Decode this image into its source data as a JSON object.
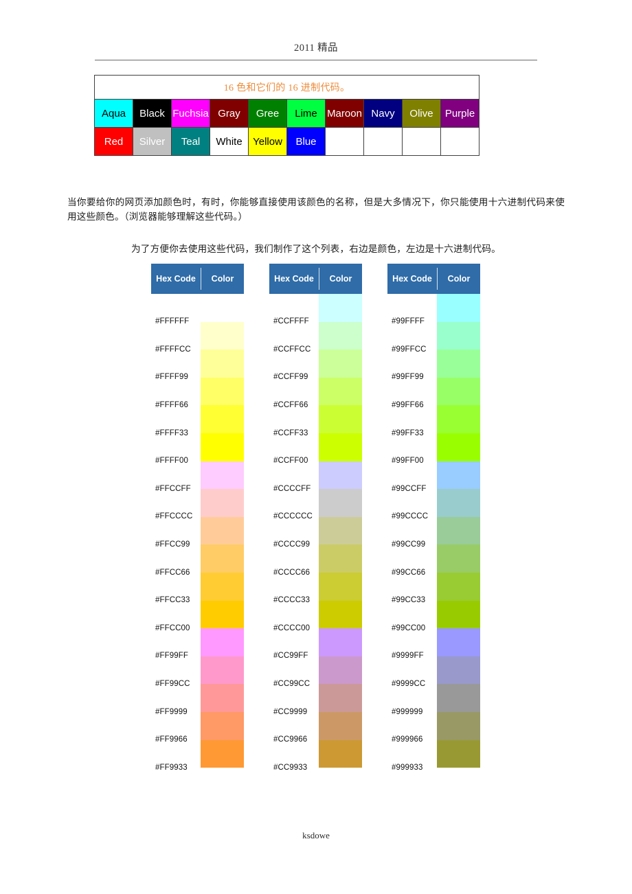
{
  "page": {
    "header_text": "2011 精品",
    "footer_text": "ksdowe"
  },
  "legend": {
    "title": "16 色和它们的 16 进制代码。",
    "title_color": "#ED8B3A",
    "row1": [
      {
        "label": "Aqua",
        "bg": "#00FFFF",
        "fg": "#000000"
      },
      {
        "label": "Black",
        "bg": "#000000",
        "fg": "#FFFFFF"
      },
      {
        "label": "Fuchsia",
        "bg": "#FF00FF",
        "fg": "#FFFFFF"
      },
      {
        "label": "Gray",
        "bg": "#800000",
        "fg": "#FFFFFF"
      },
      {
        "label": "Gree",
        "bg": "#008000",
        "fg": "#FFFFFF"
      },
      {
        "label": "Lime",
        "bg": "#00FF40",
        "fg": "#000000"
      },
      {
        "label": "Maroon",
        "bg": "#800000",
        "fg": "#FFFFFF"
      },
      {
        "label": "Navy",
        "bg": "#000080",
        "fg": "#FFFFFF"
      },
      {
        "label": "Olive",
        "bg": "#808000",
        "fg": "#FFFFFF"
      },
      {
        "label": "Purple",
        "bg": "#800080",
        "fg": "#FFFFFF"
      }
    ],
    "row2": [
      {
        "label": "Red",
        "bg": "#FF0000",
        "fg": "#FFFFFF"
      },
      {
        "label": "Silver",
        "bg": "#C0C0C0",
        "fg": "#FFFFFF"
      },
      {
        "label": "Teal",
        "bg": "#008080",
        "fg": "#FFFFFF"
      },
      {
        "label": "White",
        "bg": "#FFFFFF",
        "fg": "#000000"
      },
      {
        "label": "Yellow",
        "bg": "#FFFF00",
        "fg": "#000000"
      },
      {
        "label": "Blue",
        "bg": "#0000FF",
        "fg": "#FFFFFF"
      },
      {
        "label": "",
        "bg": "#FFFFFF",
        "fg": "#000000"
      },
      {
        "label": "",
        "bg": "#FFFFFF",
        "fg": "#000000"
      },
      {
        "label": "",
        "bg": "#FFFFFF",
        "fg": "#000000"
      },
      {
        "label": "",
        "bg": "#FFFFFF",
        "fg": "#000000"
      }
    ]
  },
  "prose": {
    "paragraph_1": "当你要给你的网页添加颜色时，有时，你能够直接使用该颜色的名称，但是大多情况下，你只能使用十六进制代码来使用这些颜色。（浏览器能够理解这些代码。）",
    "paragraph_2": "为了方便你去使用这些代码，我们制作了这个列表，右边是颜色，左边是十六进制代码。"
  },
  "chart_data": {
    "type": "table",
    "title": "Hex Code / Color reference chart",
    "header_bg": "#2F6CA8",
    "headers": [
      "Hex Code",
      "Color"
    ],
    "columns": [
      {
        "header": {
          "hex": "Hex Code",
          "color": "Color"
        },
        "clipped_row": {
          "hex": "#FFFFFF",
          "color": "#FFFFFF"
        },
        "rows": [
          {
            "hex": "#FFFFFF",
            "color": "#FFFFFF"
          },
          {
            "hex": "#FFFFCC",
            "color": "#FFFFCC"
          },
          {
            "hex": "#FFFF99",
            "color": "#FFFF99"
          },
          {
            "hex": "#FFFF66",
            "color": "#FFFF66"
          },
          {
            "hex": "#FFFF33",
            "color": "#FFFF33"
          },
          {
            "hex": "#FFFF00",
            "color": "#FFFF00"
          },
          {
            "hex": "#FFCCFF",
            "color": "#FFCCFF"
          },
          {
            "hex": "#FFCCCC",
            "color": "#FFCCCC"
          },
          {
            "hex": "#FFCC99",
            "color": "#FFCC99"
          },
          {
            "hex": "#FFCC66",
            "color": "#FFCC66"
          },
          {
            "hex": "#FFCC33",
            "color": "#FFCC33"
          },
          {
            "hex": "#FFCC00",
            "color": "#FFCC00"
          },
          {
            "hex": "#FF99FF",
            "color": "#FF99FF"
          },
          {
            "hex": "#FF99CC",
            "color": "#FF99CC"
          },
          {
            "hex": "#FF9999",
            "color": "#FF9999"
          },
          {
            "hex": "#FF9966",
            "color": "#FF9966"
          },
          {
            "hex": "#FF9933",
            "color": "#FF9933"
          }
        ]
      },
      {
        "header": {
          "hex": "Hex Code",
          "color": "Color"
        },
        "clipped_row": {
          "hex": "#CCFFFF",
          "color": "#CCFFFF"
        },
        "rows": [
          {
            "hex": "#CCFFFF",
            "color": "#CCFFFF"
          },
          {
            "hex": "#CCFFCC",
            "color": "#CCFFCC"
          },
          {
            "hex": "#CCFF99",
            "color": "#CCFF99"
          },
          {
            "hex": "#CCFF66",
            "color": "#CCFF66"
          },
          {
            "hex": "#CCFF33",
            "color": "#CCFF33"
          },
          {
            "hex": "#CCFF00",
            "color": "#CCFF00"
          },
          {
            "hex": "#CCCCFF",
            "color": "#CCCCFF"
          },
          {
            "hex": "#CCCCCC",
            "color": "#CCCCCC"
          },
          {
            "hex": "#CCCC99",
            "color": "#CCCC99"
          },
          {
            "hex": "#CCCC66",
            "color": "#CCCC66"
          },
          {
            "hex": "#CCCC33",
            "color": "#CCCC33"
          },
          {
            "hex": "#CCCC00",
            "color": "#CCCC00"
          },
          {
            "hex": "#CC99FF",
            "color": "#CC99FF"
          },
          {
            "hex": "#CC99CC",
            "color": "#CC99CC"
          },
          {
            "hex": "#CC9999",
            "color": "#CC9999"
          },
          {
            "hex": "#CC9966",
            "color": "#CC9966"
          },
          {
            "hex": "#CC9933",
            "color": "#CC9933"
          }
        ]
      },
      {
        "header": {
          "hex": "Hex Code",
          "color": "Color"
        },
        "clipped_row": {
          "hex": "#99FFFF",
          "color": "#99FFFF"
        },
        "rows": [
          {
            "hex": "#99FFFF",
            "color": "#99FFFF"
          },
          {
            "hex": "#99FFCC",
            "color": "#99FFCC"
          },
          {
            "hex": "#99FF99",
            "color": "#99FF99"
          },
          {
            "hex": "#99FF66",
            "color": "#99FF66"
          },
          {
            "hex": "#99FF33",
            "color": "#99FF33"
          },
          {
            "hex": "#99FF00",
            "color": "#99FF00"
          },
          {
            "hex": "#99CCFF",
            "color": "#99CCFF"
          },
          {
            "hex": "#99CCCC",
            "color": "#99CCCC"
          },
          {
            "hex": "#99CC99",
            "color": "#99CC99"
          },
          {
            "hex": "#99CC66",
            "color": "#99CC66"
          },
          {
            "hex": "#99CC33",
            "color": "#99CC33"
          },
          {
            "hex": "#99CC00",
            "color": "#99CC00"
          },
          {
            "hex": "#9999FF",
            "color": "#9999FF"
          },
          {
            "hex": "#9999CC",
            "color": "#9999CC"
          },
          {
            "hex": "#999999",
            "color": "#999999"
          },
          {
            "hex": "#999966",
            "color": "#999966"
          },
          {
            "hex": "#999933",
            "color": "#999933"
          }
        ]
      }
    ]
  }
}
